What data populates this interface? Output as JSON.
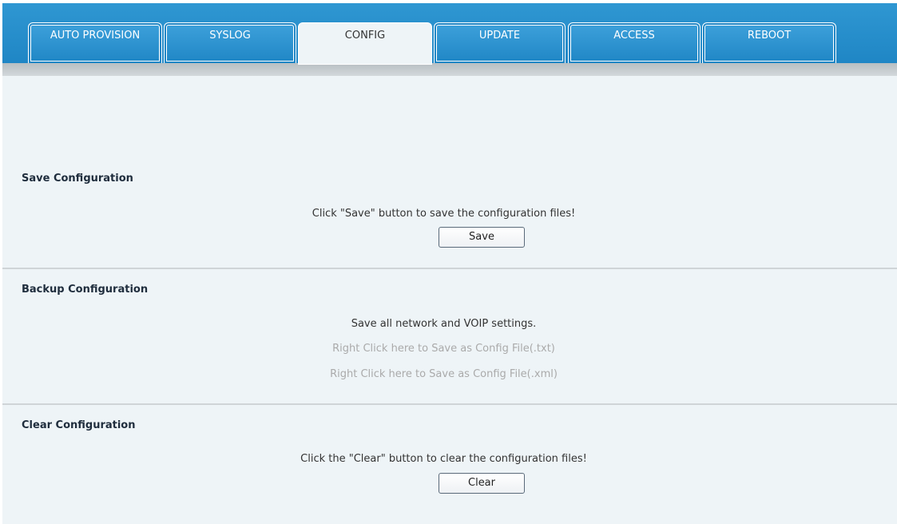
{
  "tabs": [
    {
      "label": "AUTO PROVISION",
      "active": false
    },
    {
      "label": "SYSLOG",
      "active": false
    },
    {
      "label": "CONFIG",
      "active": true
    },
    {
      "label": "UPDATE",
      "active": false
    },
    {
      "label": "ACCESS",
      "active": false
    },
    {
      "label": "REBOOT",
      "active": false
    }
  ],
  "save_section": {
    "title": "Save Configuration",
    "description": "Click \"Save\" button to save the configuration files!",
    "button_label": "Save"
  },
  "backup_section": {
    "title": "Backup Configuration",
    "description": "Save all network and VOIP settings.",
    "link_txt": "Right Click here to Save as Config File(.txt)",
    "link_xml": "Right Click here to Save as Config File(.xml)"
  },
  "clear_section": {
    "title": "Clear Configuration",
    "description": "Click the \"Clear\" button to clear the configuration files!",
    "button_label": "Clear"
  },
  "colors": {
    "header_blue": "#1f86c5",
    "page_background": "#eef4f7",
    "link_gray": "#aaaaaa"
  }
}
